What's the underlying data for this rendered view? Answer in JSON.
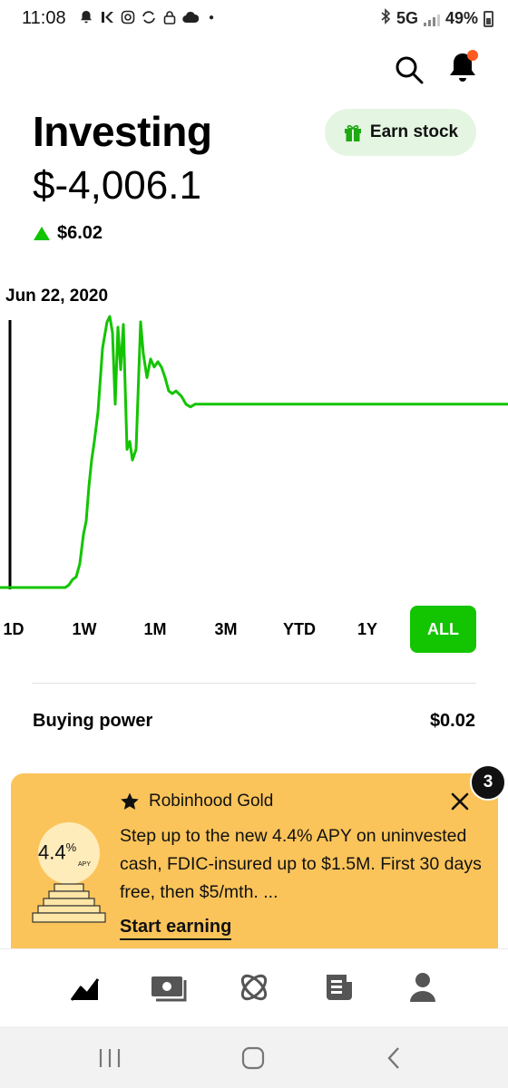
{
  "status": {
    "time": "11:08",
    "network": "5G",
    "battery": "49%"
  },
  "header": {
    "title": "Investing",
    "earn_label": "Earn stock"
  },
  "portfolio": {
    "balance": "$-4,006.1",
    "change": "$6.02",
    "chart_date": "Jun 22, 2020"
  },
  "ranges": [
    "1D",
    "1W",
    "1M",
    "3M",
    "YTD",
    "1Y",
    "ALL"
  ],
  "active_range": "ALL",
  "buying_power": {
    "label": "Buying power",
    "value": "$0.02"
  },
  "gold_card": {
    "badge_count": "3",
    "title": "Robinhood Gold",
    "body": "Step up to the new 4.4% APY on uninvested cash, FDIC-insured up to $1.5M. First 30 days free, then $5/mth. ...",
    "cta": "Start earning",
    "rate": "4.4",
    "rate_unit": "%",
    "rate_sub": "APY"
  },
  "colors": {
    "accent_green": "#13c400",
    "gold": "#fbc45a",
    "notification_dot": "#ff5a1f"
  },
  "icons": {
    "status_left": [
      "notification-bell-icon",
      "app-icon",
      "instagram-icon",
      "sync-icon",
      "lock-icon",
      "cloud-icon"
    ],
    "nav": [
      "investing-chart-icon",
      "cash-icon",
      "crypto-icon",
      "news-icon",
      "account-icon"
    ]
  },
  "chart_data": {
    "type": "line",
    "title": "",
    "xlabel": "",
    "ylabel": "",
    "series": [
      {
        "values": [
          0,
          0,
          0,
          0,
          0,
          0,
          0,
          1,
          3,
          4,
          9,
          20,
          25,
          38,
          48,
          55,
          66,
          90,
          100,
          102,
          96,
          69,
          98,
          82,
          99,
          52,
          55,
          48,
          52,
          100,
          88,
          79,
          86,
          83,
          85,
          83,
          79,
          74,
          73,
          74,
          72,
          69,
          68,
          69,
          69,
          69,
          69,
          69,
          69,
          69,
          69,
          69,
          69,
          69,
          69,
          69
        ]
      }
    ],
    "ylim": [
      0,
      100
    ],
    "grid": false,
    "legend": "none",
    "scrubber_date": "Jun 22, 2020"
  }
}
